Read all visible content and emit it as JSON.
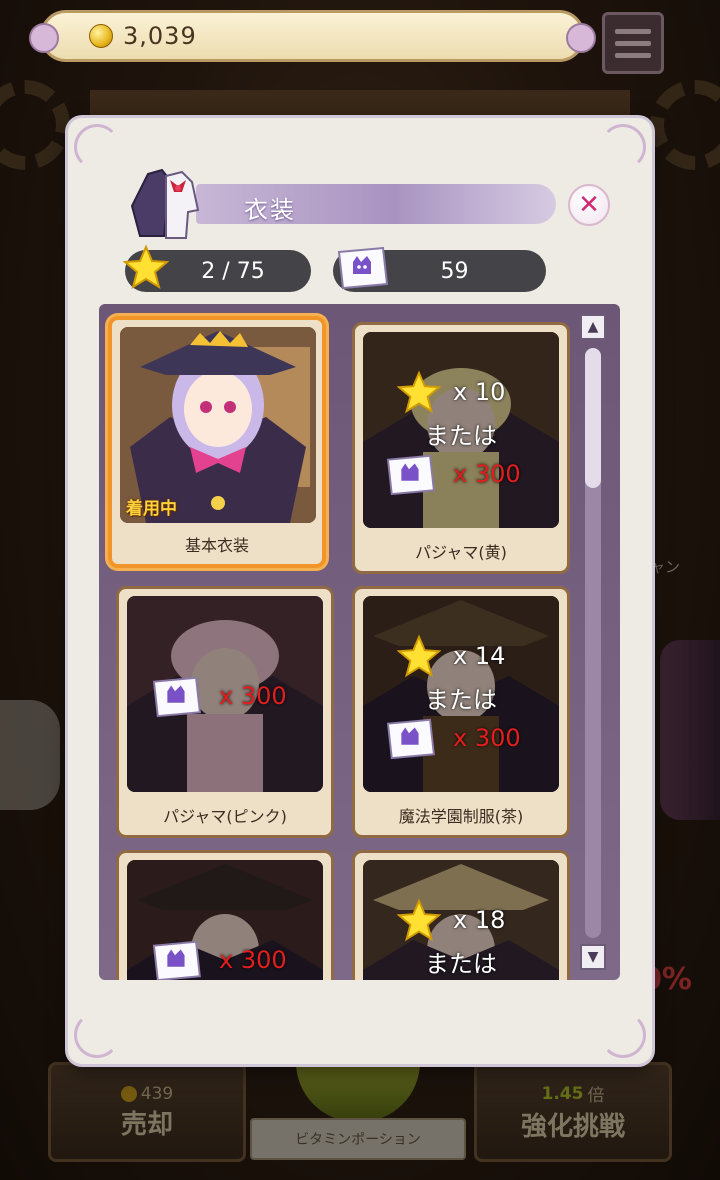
{
  "header": {
    "coins": "3,039"
  },
  "dialog": {
    "title": "衣装",
    "stars_owned": "2 / 75",
    "tickets_owned": "59"
  },
  "outfits": [
    {
      "name": "基本衣装",
      "status": "着用中",
      "selected": true
    },
    {
      "name": "パジャマ(黄)",
      "star_cost": "x 10",
      "or_text": "または",
      "ticket_cost": "x 300"
    },
    {
      "name": "パジャマ(ピンク)",
      "ticket_cost": "x 300"
    },
    {
      "name": "魔法学園制服(茶)",
      "star_cost": "x 14",
      "or_text": "または",
      "ticket_cost": "x 300"
    },
    {
      "name": "",
      "ticket_cost": "x 300"
    },
    {
      "name": "",
      "star_cost": "x 18",
      "or_text": "または"
    }
  ],
  "background": {
    "right_label": "ャン",
    "percent": "0%",
    "sell_button": {
      "price": "439",
      "label": "売却"
    },
    "enhance_button": {
      "multiplier": "1.45",
      "unit": "倍",
      "label": "強化挑戦"
    },
    "potion_label": "ビタミンポーション"
  },
  "colors": {
    "accent": "#f1952a",
    "cost_red": "#e21e1e",
    "panel": "#6c5876"
  }
}
